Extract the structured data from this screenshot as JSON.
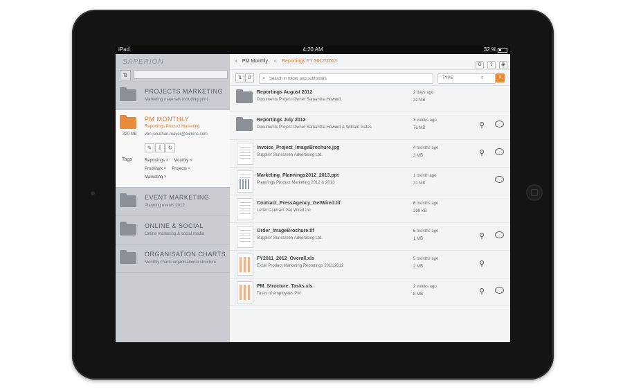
{
  "statusbar": {
    "carrier": "iPad",
    "time": "4:20 AM",
    "battery": "32 %"
  },
  "brand": {
    "logo": "SAPERION"
  },
  "sidebar": {
    "search_placeholder": "",
    "folders_top": [
      {
        "title": "PROJECTS MARKETING",
        "subtitle": "Marketing materials including print"
      }
    ],
    "selected": {
      "title": "PM MONTHLY",
      "subtitle": "Reportings Product Marketing",
      "size": "320 MB",
      "owner": "von    jonathan.mayer@exminc.com",
      "tags_label": "Tags",
      "tags": [
        "Reportings ×",
        "Monthly ×",
        "ProdMark ×",
        "Projects ×",
        "Marketing ×"
      ]
    },
    "folders_bottom": [
      {
        "title": "EVENT MARKETING",
        "subtitle": "Planning events 2012"
      },
      {
        "title": "ONLINE & SOCIAL",
        "subtitle": "Online marketing & social media"
      },
      {
        "title": "ORGANISATION CHARTS",
        "subtitle": "Monthly charts organisational structure"
      }
    ]
  },
  "nav": {
    "back_glyph": "‹",
    "crumb1": "PM Monthly",
    "crumb2": "Reportings FY 2012/2013"
  },
  "filter": {
    "search_placeholder": "Search in folder and subfolders",
    "type_label": "TYPE"
  },
  "files": [
    {
      "name": "Reportings August 2012",
      "desc": "Documents Project Owner Samantha Howard",
      "date": "2 days ago",
      "size": "32 MB",
      "thumb": "folder",
      "link": false,
      "comment": false
    },
    {
      "name": "Reportings July 2012",
      "desc": "Documents Project Owner Samantha Howard & William Gates",
      "date": "3 weeks ago",
      "size": "76 MB",
      "thumb": "folder",
      "link": true,
      "comment": true
    },
    {
      "name": "Invoice_Project_ImageBrochure.jpg",
      "desc": "Supplier Sunscreen Advertising Ltd.",
      "date": "4 months ago",
      "size": "3 MB",
      "thumb": "doc",
      "link": true,
      "comment": true
    },
    {
      "name": "Marketing_Plannings2012_2013.ppt",
      "desc": "Plannings Product Marketing 2012 & 2013",
      "date": "1 month ago",
      "size": "31 MB",
      "thumb": "chart",
      "link": false,
      "comment": true
    },
    {
      "name": "Contract_PressAgency_GetWired.tif",
      "desc": "Letter Contract Get Wired Inc.",
      "date": "8 months ago",
      "size": "290 KB",
      "thumb": "doc",
      "link": false,
      "comment": false
    },
    {
      "name": "Order_ImageBrochure.tif",
      "desc": "Supplier Sunscreen Advertising Ltd.",
      "date": "6 months ago",
      "size": "1 MB",
      "thumb": "doc",
      "link": true,
      "comment": true
    },
    {
      "name": "FY2011_2012_Overall.xls",
      "desc": "Excel Product Marketing Reportings 2011/2012",
      "date": "5 months ago",
      "size": "2 MB",
      "thumb": "sheet",
      "link": true,
      "comment": false
    },
    {
      "name": "PM_Structure_Tasks.xls",
      "desc": "Tasks of employees PM",
      "date": "2 weeks ago",
      "size": "8 MB",
      "thumb": "sheet",
      "link": true,
      "comment": true
    }
  ]
}
